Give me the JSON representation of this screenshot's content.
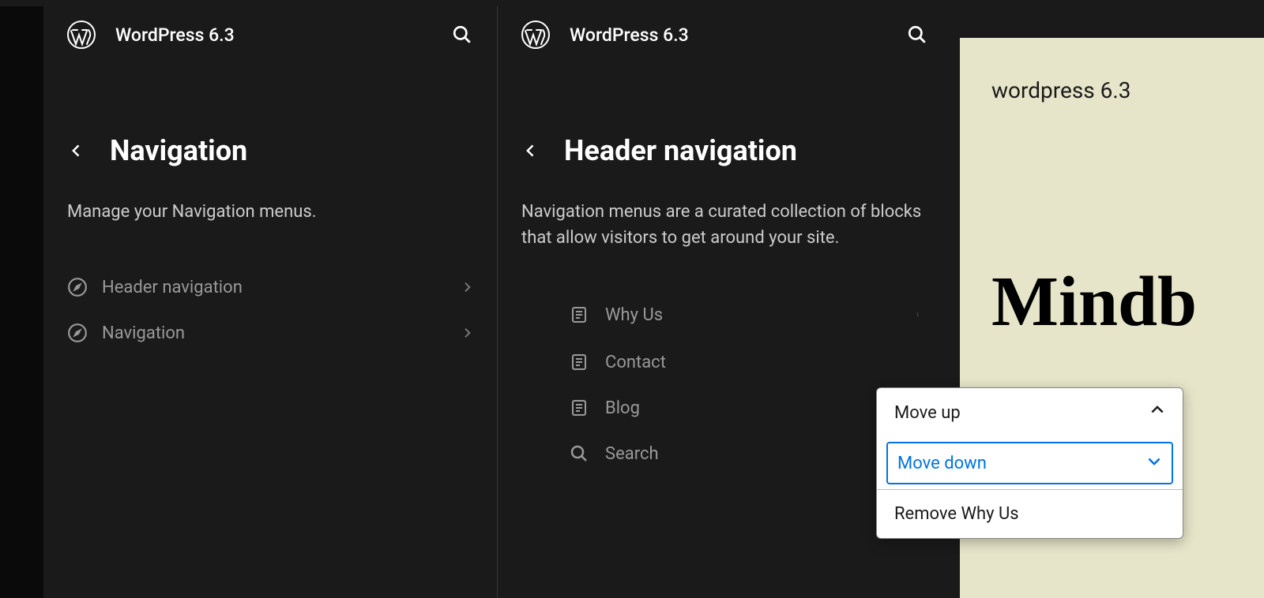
{
  "app": {
    "title": "WordPress 6.3"
  },
  "panel1": {
    "title": "Navigation",
    "desc": "Manage your Navigation menus.",
    "items": [
      {
        "label": "Header navigation"
      },
      {
        "label": "Navigation"
      }
    ]
  },
  "panel2": {
    "title": "Header navigation",
    "desc": "Navigation menus are a curated collection of blocks that allow visitors to get around your site.",
    "pages": [
      {
        "label": "Why Us",
        "type": "page"
      },
      {
        "label": "Contact",
        "type": "page"
      },
      {
        "label": "Blog",
        "type": "page"
      },
      {
        "label": "Search",
        "type": "search"
      }
    ]
  },
  "preview": {
    "brand": "wordpress 6.3",
    "hero": "Mindb"
  },
  "dropdown": {
    "move_up": "Move up",
    "move_down": "Move down",
    "remove": "Remove Why Us"
  }
}
